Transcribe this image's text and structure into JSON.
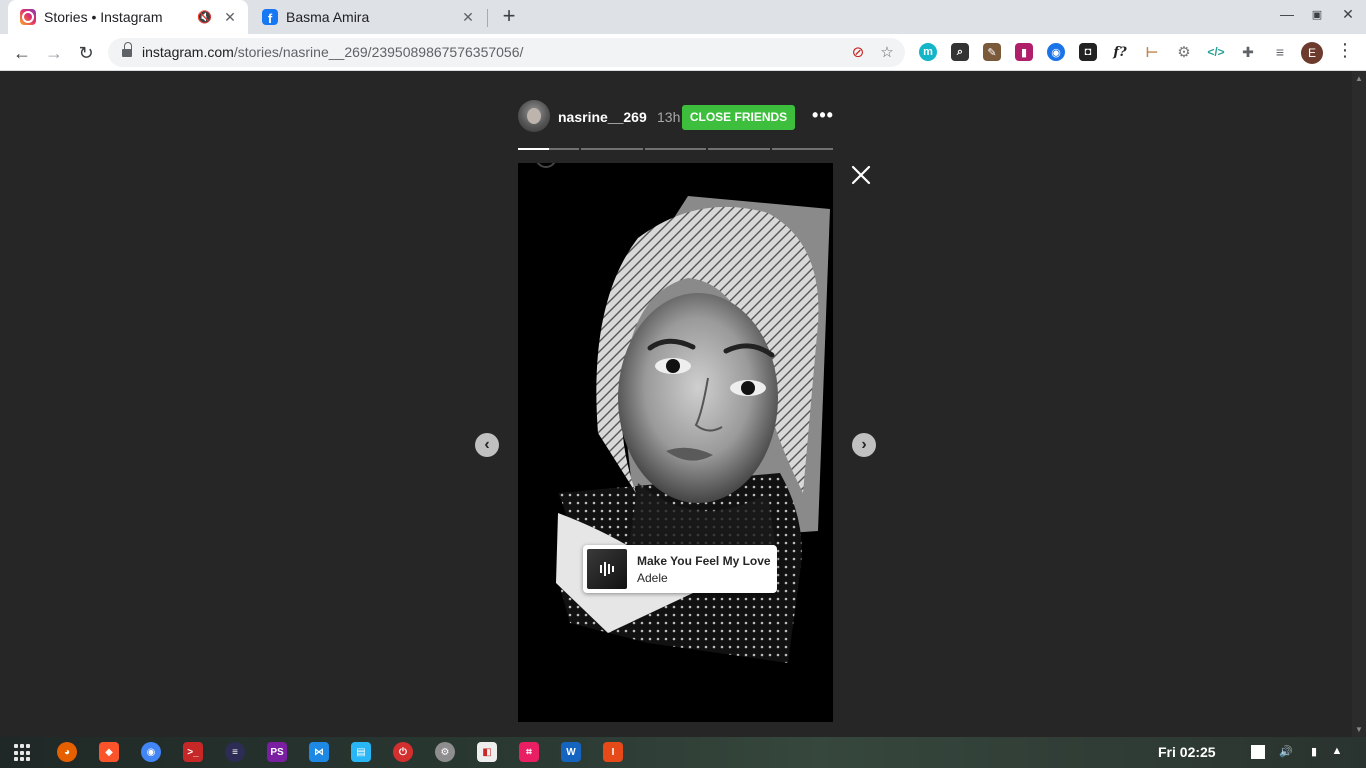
{
  "browser": {
    "tabs": [
      {
        "title": "Stories • Instagram",
        "active": true,
        "favicon": "instagram-icon"
      },
      {
        "title": "Basma Amira",
        "active": false,
        "favicon": "facebook-icon"
      }
    ],
    "url_host": "instagram.com",
    "url_path": "/stories/nasrine__269/2395089867576357056/",
    "profile_initial": "E"
  },
  "story": {
    "username": "nasrine__269",
    "time_ago": "13h",
    "badge": "CLOSE FRIENDS",
    "segments": [
      0.5,
      0,
      0,
      0,
      0
    ],
    "music": {
      "title": "Make You Feel My Love",
      "artist": "Adele"
    }
  },
  "taskbar": {
    "clock": "Fri 02:25"
  },
  "colors": {
    "page_bg": "#262626",
    "close_friends_green": "#3dbf3d"
  }
}
